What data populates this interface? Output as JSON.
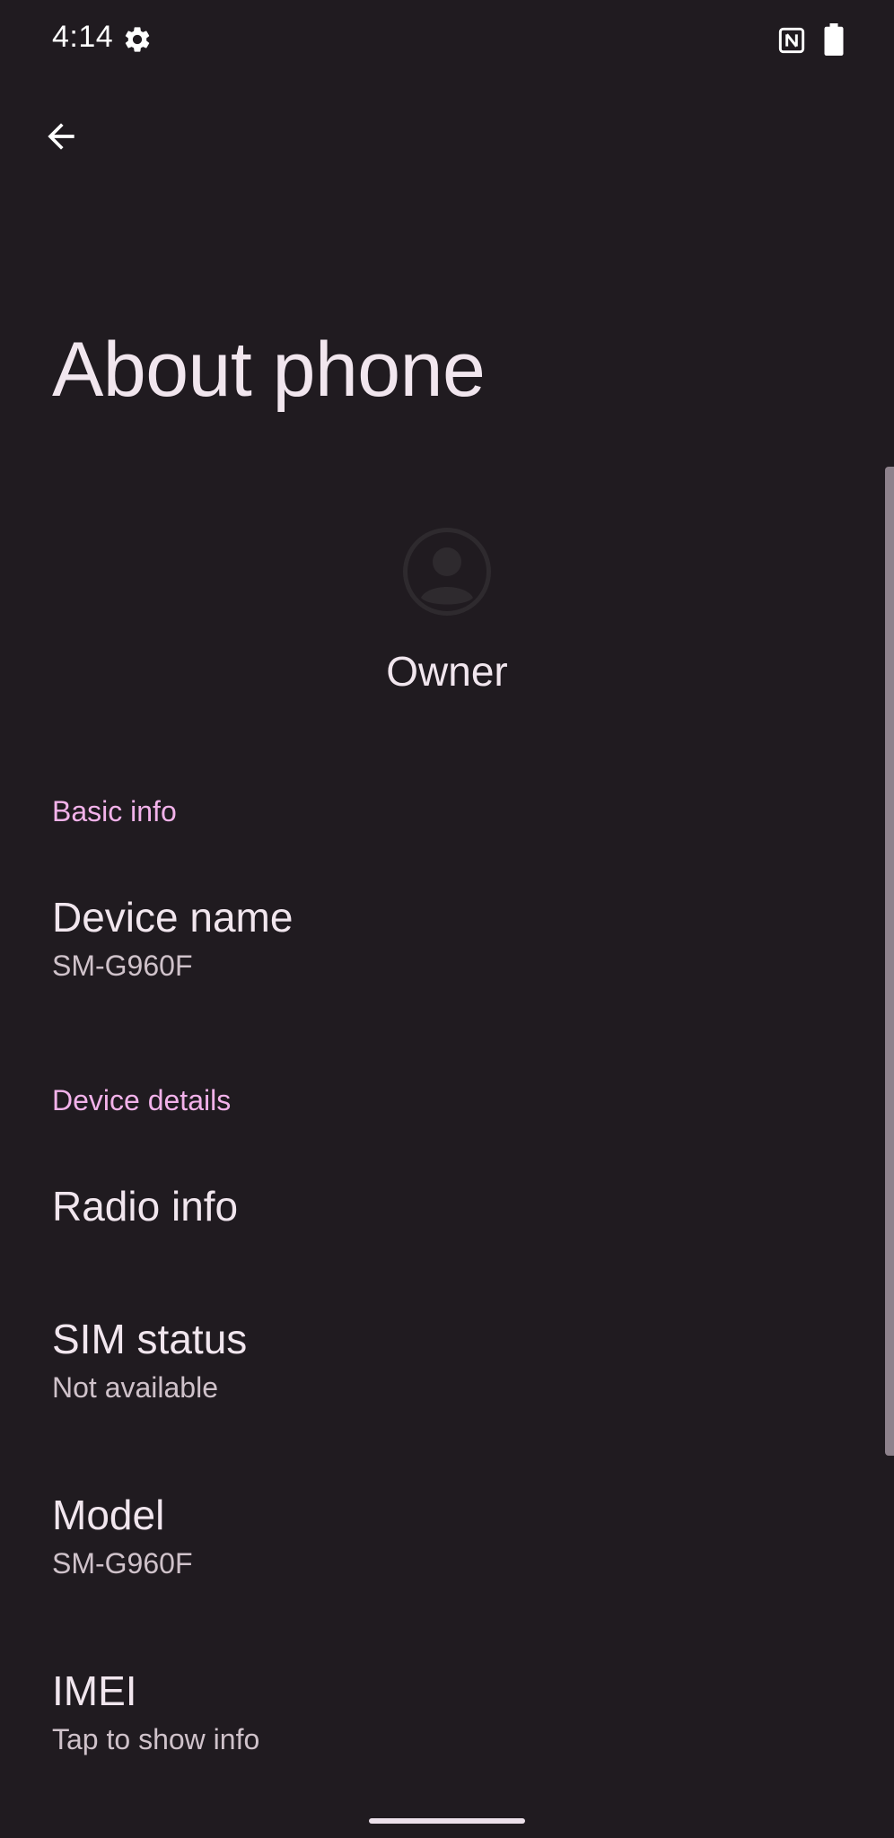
{
  "status_bar": {
    "time": "4:14",
    "icons": [
      "gear-icon",
      "nfc-icon",
      "battery-icon"
    ]
  },
  "header": {
    "back_icon": "arrow-back-icon",
    "title": "About phone"
  },
  "profile": {
    "avatar_icon": "account-circle-icon",
    "name": "Owner"
  },
  "sections": {
    "basic_info": {
      "header": "Basic info",
      "device_name": {
        "title": "Device name",
        "summary": "SM-G960F"
      }
    },
    "device_details": {
      "header": "Device details",
      "radio_info": {
        "title": "Radio info"
      },
      "sim_status": {
        "title": "SIM status",
        "summary": "Not available"
      },
      "model": {
        "title": "Model",
        "summary": "SM-G960F"
      },
      "imei": {
        "title": "IMEI",
        "summary": "Tap to show info"
      }
    }
  },
  "colors": {
    "background": "#201b20",
    "accent": "#f2b2ea",
    "primary_text": "#f1e6ee",
    "secondary_text": "#cfc2ca"
  }
}
